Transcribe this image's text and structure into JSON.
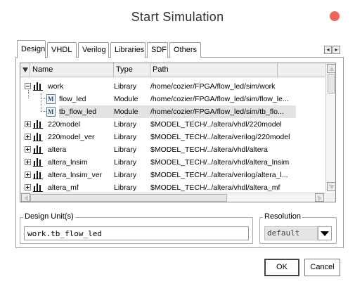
{
  "window": {
    "title": "Start Simulation"
  },
  "tabs": [
    {
      "label": "Design",
      "active": true
    },
    {
      "label": "VHDL",
      "active": false
    },
    {
      "label": "Verilog",
      "active": false
    },
    {
      "label": "Libraries",
      "active": false
    },
    {
      "label": "SDF",
      "active": false
    },
    {
      "label": "Others",
      "active": false
    }
  ],
  "tab_scroll": {
    "left": "◂",
    "right": "▸"
  },
  "table": {
    "columns": [
      "Name",
      "Type",
      "Path"
    ],
    "rows": [
      {
        "name": "work",
        "type": "Library",
        "path": "/home/cozier/FPGA/flow_led/sim/work",
        "level": 0,
        "expander": "minus",
        "icon": "library-icon",
        "selected": false
      },
      {
        "name": "flow_led",
        "type": "Module",
        "path": "/home/cozier/FPGA/flow_led/sim/flow_le...",
        "level": 1,
        "expander": "none",
        "icon": "module-icon",
        "selected": false
      },
      {
        "name": "tb_flow_led",
        "type": "Module",
        "path": "/home/cozier/FPGA/flow_led/sim/tb_flo...",
        "level": 1,
        "expander": "none",
        "icon": "module-icon",
        "selected": true
      },
      {
        "name": "220model",
        "type": "Library",
        "path": "$MODEL_TECH/../altera/vhdl/220model",
        "level": 0,
        "expander": "plus",
        "icon": "library-icon",
        "selected": false
      },
      {
        "name": "220model_ver",
        "type": "Library",
        "path": "$MODEL_TECH/../altera/verilog/220model",
        "level": 0,
        "expander": "plus",
        "icon": "library-icon",
        "selected": false
      },
      {
        "name": "altera",
        "type": "Library",
        "path": "$MODEL_TECH/../altera/vhdl/altera",
        "level": 0,
        "expander": "plus",
        "icon": "library-icon",
        "selected": false
      },
      {
        "name": "altera_lnsim",
        "type": "Library",
        "path": "$MODEL_TECH/../altera/vhdl/altera_lnsim",
        "level": 0,
        "expander": "plus",
        "icon": "library-icon",
        "selected": false
      },
      {
        "name": "altera_lnsim_ver",
        "type": "Library",
        "path": "$MODEL_TECH/../altera/verilog/altera_l...",
        "level": 0,
        "expander": "plus",
        "icon": "library-icon",
        "selected": false
      },
      {
        "name": "altera_mf",
        "type": "Library",
        "path": "$MODEL_TECH/../altera/vhdl/altera_mf",
        "level": 0,
        "expander": "plus",
        "icon": "library-icon",
        "selected": false
      }
    ]
  },
  "design_unit": {
    "label": "Design Unit(s)",
    "value": "work.tb_flow_led"
  },
  "resolution": {
    "label": "Resolution",
    "value": "default"
  },
  "buttons": {
    "ok": "OK",
    "cancel": "Cancel"
  },
  "colors": {
    "close": "#f0655b",
    "selection": "#e3e3e3"
  }
}
